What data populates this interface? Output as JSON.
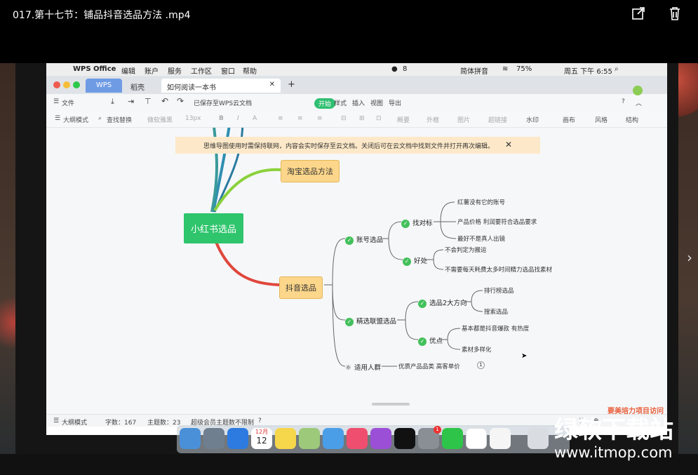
{
  "viewer": {
    "title": "017.第十七节：铺品抖音选品方法  .mp4"
  },
  "menubar": {
    "app": "WPS Office",
    "items": [
      "编辑",
      "账户",
      "服务",
      "工作区",
      "窗口",
      "帮助"
    ],
    "badge_count": "8",
    "ime": "简体拼音",
    "battery": "75%",
    "clock": "周五 下午 6:55"
  },
  "tabs": [
    {
      "label": "WPS"
    },
    {
      "label": "稻壳"
    },
    {
      "label": "如何阅读一本书"
    }
  ],
  "toolbar": {
    "file": "文件",
    "saved_status": "已保存至WPS云文档",
    "menu_tabs": [
      "开始",
      "样式",
      "插入",
      "视图",
      "导出"
    ]
  },
  "format_toolbar": {
    "outline_mode": "大纲模式",
    "find_replace": "查找替换",
    "font": "微软雅黑",
    "size": "13px",
    "items": [
      "概要",
      "外框",
      "图片",
      "超链接",
      "水印",
      "画布",
      "风格",
      "结构"
    ]
  },
  "notice": {
    "text": "思维导图使用时需保持联网，内容会实时保存至云文档。关闭后可在云文档中找到文件并打开再次编辑。"
  },
  "mindmap": {
    "root": "小红书选品",
    "branch_taobao": "淘宝选品方法",
    "branch_douyin": "抖音选品",
    "account": "账号选品",
    "find_target": "找对标",
    "find_target_leaves": [
      "红薯没有它的账号",
      "产品价格 利润要符合选品要求",
      "最好不是真人出镜"
    ],
    "benefit": "好处",
    "benefit_leaves": [
      "不会判定为搬运",
      "不需要每天耗费太多时间精力选品找素材"
    ],
    "alliance": "精选联盟选品",
    "two_directions": "选品2大方向",
    "two_directions_leaves": [
      "排行榜选品",
      "搜索选品"
    ],
    "advantages": "优点",
    "advantages_leaves": [
      "基本都是抖音爆款 有热度",
      "素材多样化"
    ],
    "audience": "适用人群",
    "audience_leaf": "优质产品品类 高客单价",
    "audience_count": "1"
  },
  "statusbar": {
    "outline_mode": "大纲模式",
    "word_count": "字数：167",
    "topic_count": "主题数：23",
    "vip": "超级会员主题数不限制"
  },
  "dock": {
    "calendar_month": "12月",
    "calendar_day": "12",
    "settings_badge": "1"
  },
  "watermark": {
    "line1": "绿软下载站",
    "line2": "www.itmop.com",
    "sticker": "要美培力项目访问"
  },
  "colors": {
    "root_green": "#2ec56c",
    "branch_yellow": "#fcd68a",
    "line_red": "#e0473c",
    "line_green": "#8bd13b",
    "line_blue": "#2f8fb0",
    "check_green": "#43c05b"
  }
}
